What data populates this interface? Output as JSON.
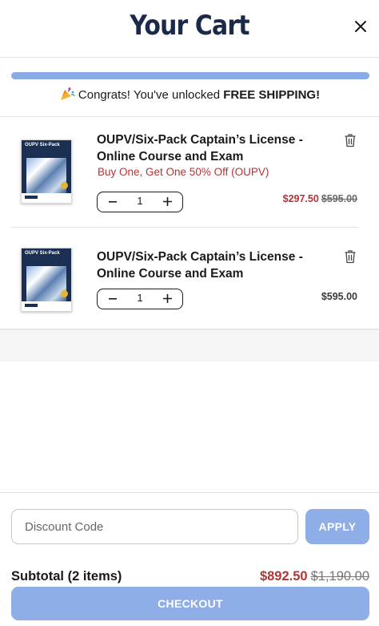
{
  "header": {
    "title": "Your Cart",
    "close_icon": "close-icon"
  },
  "shipping_banner": {
    "progress_fraction": 1.0,
    "bar_color": "#8aabe6",
    "emoji_icon": "party-popper-icon",
    "message_prefix": "Congrats! You've unlocked",
    "message_bold": "FREE SHIPPING!"
  },
  "cart_items": [
    {
      "name": "OUPV/Six-Pack Captain’s License - Online Course and Exam",
      "promo": "Buy One, Get One 50% Off (OUPV)",
      "quantity": "1",
      "sale_price": "$297.50",
      "original_price": "$595.00",
      "thumb_title": "OUPV Six-Pack",
      "remove_icon": "trash-icon"
    },
    {
      "name": "OUPV/Six-Pack Captain’s License - Online Course and Exam",
      "promo": "",
      "quantity": "1",
      "price": "$595.00",
      "thumb_title": "OUPV Six-Pack",
      "remove_icon": "trash-icon"
    }
  ],
  "discount": {
    "placeholder": "Discount Code",
    "value": "",
    "apply_label": "APPLY"
  },
  "summary": {
    "subtotal_label": "Subtotal (2 items)",
    "subtotal_sale": "$892.50",
    "subtotal_original": "$1,190.00",
    "checkout_label": "CHECKOUT"
  },
  "colors": {
    "accent": "#8fade6",
    "sale_red": "#b23535",
    "title_navy": "#1c2a4a"
  }
}
